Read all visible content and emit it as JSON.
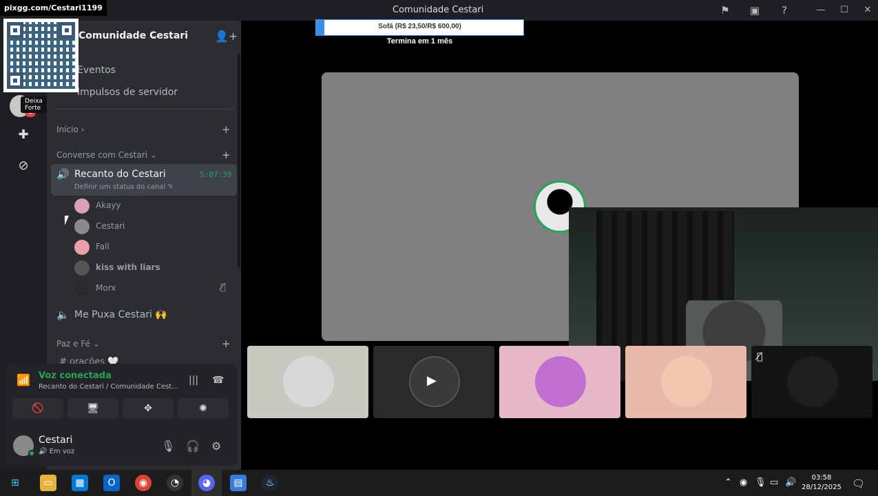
{
  "window": {
    "title": "Comunidade Cestari"
  },
  "overlay": {
    "link": "pixgg.com/Cestari1199"
  },
  "rail": {
    "tooltip": "Deixa Forte",
    "badge": "1",
    "add_icon": "plus-icon",
    "explore_icon": "compass-icon"
  },
  "server": {
    "name": "Comunidade Cestari",
    "menu": [
      "Eventos",
      "Impulsos de servidor"
    ],
    "categories": {
      "inicio": "Início",
      "converse": "Converse com Cestari",
      "paz": "Paz e Fé"
    },
    "voice_channel": {
      "name": "Recanto do Cestari",
      "timer": "5:07:39",
      "status": "Definir um status do canal"
    },
    "members": [
      {
        "name": "Akayy",
        "color": "#d9a0b5"
      },
      {
        "name": "Cestari",
        "color": "#8a8a8a"
      },
      {
        "name": "Fall",
        "color": "#e8a0a8"
      },
      {
        "name": "kiss with liars",
        "color": "#555555"
      },
      {
        "name": "Morx",
        "color": "#2a2a2a"
      }
    ],
    "voice_channel_2": "Me Puxa Cestari 🙌",
    "text_channel": "# orações 🤍"
  },
  "voice_panel": {
    "title": "Voz conectada",
    "subtitle": "Recanto do Cestari / Comunidade Cest..."
  },
  "user_panel": {
    "name": "Cestari",
    "status": "Em voz"
  },
  "stage": {
    "goal_label": "Sofá (R$ 23,50/R$ 600,00)",
    "goal_progress": 0.04,
    "goal_sub": "Termina em 1 mês"
  },
  "tiles": [
    {
      "color": "#c9c9c1",
      "circle": "#d8d8d8"
    },
    {
      "color": "#2a2a2a",
      "circle": "#3a3a3a"
    },
    {
      "color": "#e6b8c8",
      "circle": "#c070d0"
    },
    {
      "color": "#e8b8a8",
      "circle": "#f0c8b0"
    },
    {
      "color": "#141414",
      "circle": "#1e1e1e"
    }
  ],
  "taskbar": {
    "time": "03:58",
    "date": "28/12/2025"
  },
  "colors": {
    "accent_green": "#23a55a",
    "sidebar": "#2b2d31",
    "rail": "#1e1f22",
    "goal_fill": "#3a8ee6"
  }
}
